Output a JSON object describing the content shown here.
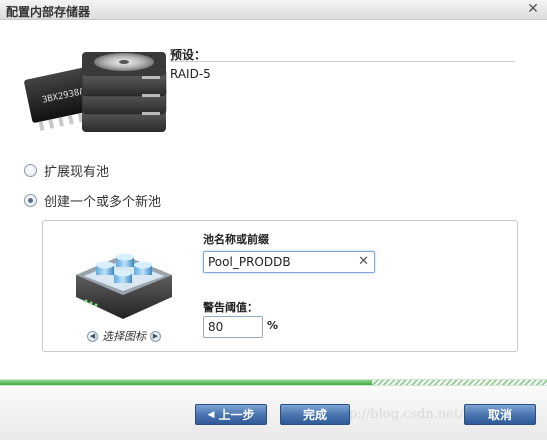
{
  "dialog": {
    "title": "配置内部存储器"
  },
  "preset": {
    "label": "预设：",
    "value": "RAID-5"
  },
  "options": [
    {
      "label": "扩展现有池",
      "checked": false
    },
    {
      "label": "创建一个或多个新池",
      "checked": true
    }
  ],
  "pool": {
    "name_label": "池名称或前缀",
    "name_value": "Pool_PRODDB",
    "threshold_label": "警告阈值：",
    "threshold_value": "80",
    "threshold_unit": "%",
    "icon_picker_label": "选择图标"
  },
  "progress": {
    "fraction": 0.68
  },
  "buttons": {
    "back": "上一步",
    "finish": "完成",
    "cancel": "取消"
  },
  "watermark": "http://blog.csdn.net/",
  "colors": {
    "button_blue": "#3d67a6",
    "progress_green": "#3ea83e",
    "accent_border": "#7fa8d2"
  }
}
